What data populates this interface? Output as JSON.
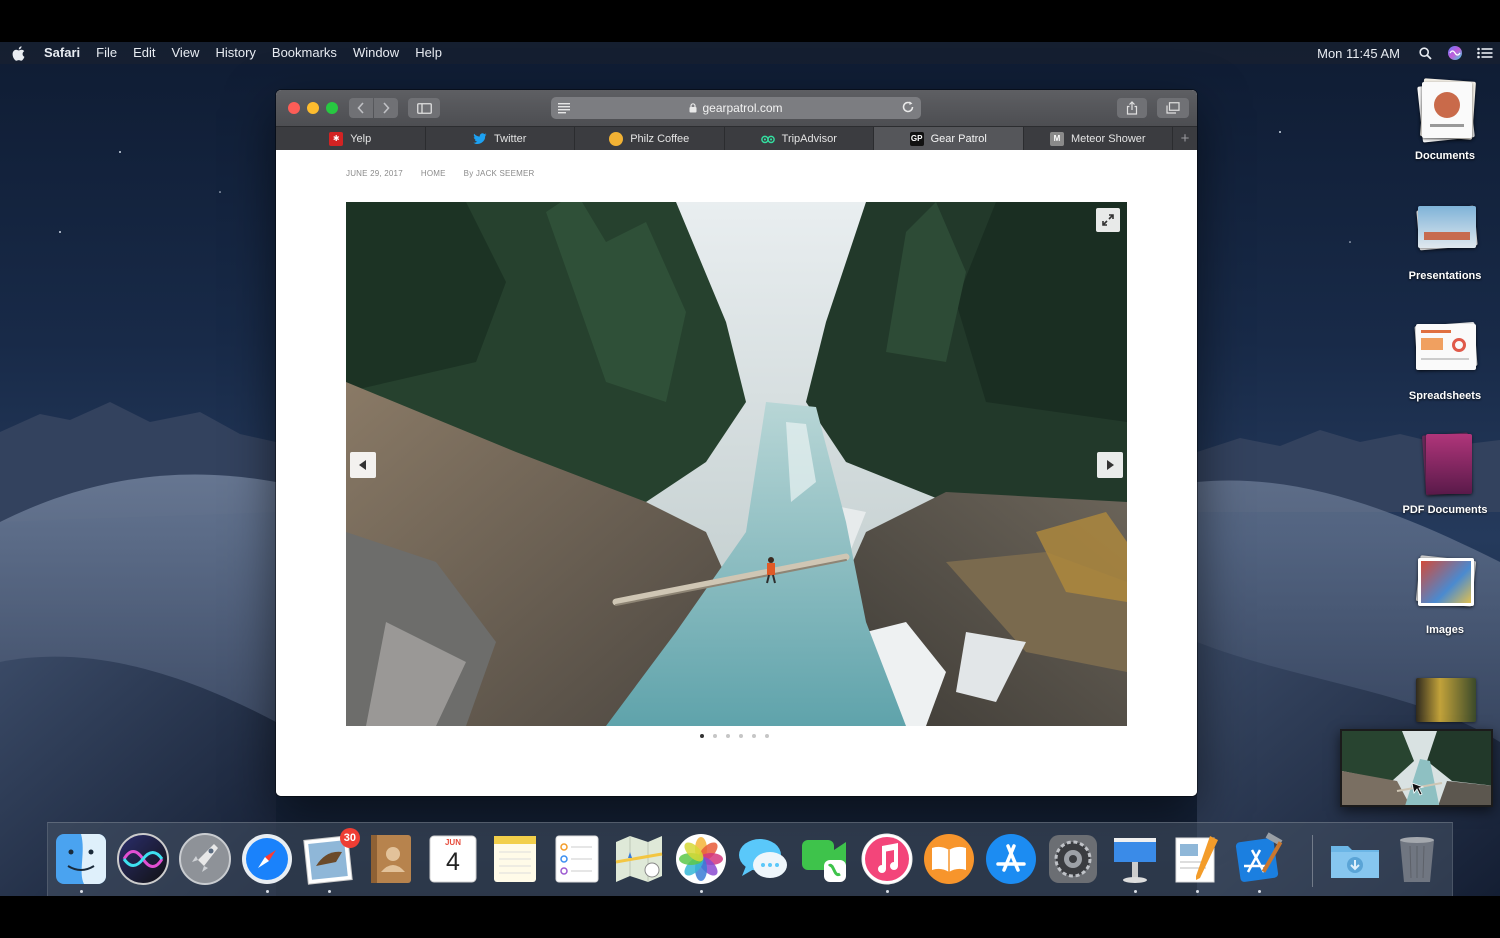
{
  "menubar": {
    "app_name": "Safari",
    "menus": [
      "File",
      "Edit",
      "View",
      "History",
      "Bookmarks",
      "Window",
      "Help"
    ],
    "clock": "Mon 11:45 AM",
    "icons": [
      "apple-icon",
      "spotlight-search-icon",
      "siri-icon",
      "notification-center-icon"
    ]
  },
  "safari": {
    "address": "gearpatrol.com",
    "tabs": [
      {
        "label": "Yelp",
        "icon": "yelp-favicon",
        "color": "#d32323"
      },
      {
        "label": "Twitter",
        "icon": "twitter-favicon",
        "color": "#1da1f2"
      },
      {
        "label": "Philz Coffee",
        "icon": "philz-favicon",
        "color": "#f2b234"
      },
      {
        "label": "TripAdvisor",
        "icon": "tripadvisor-favicon",
        "color": "#34e0a1"
      },
      {
        "label": "Gear Patrol",
        "icon": "gearpatrol-favicon",
        "color": "#111111",
        "active": true
      },
      {
        "label": "Meteor Shower",
        "icon": "m-favicon",
        "color": "#8a8a8a"
      }
    ],
    "article": {
      "date": "JUNE 29, 2017",
      "section": "HOME",
      "byline": "By JACK SEEMER"
    },
    "gallery": {
      "slides": 6,
      "current": 1
    }
  },
  "stacks": [
    {
      "label": "Documents",
      "icon": "documents-stack-icon"
    },
    {
      "label": "Presentations",
      "icon": "presentations-stack-icon"
    },
    {
      "label": "Spreadsheets",
      "icon": "spreadsheets-stack-icon"
    },
    {
      "label": "PDF Documents",
      "icon": "pdf-documents-stack-icon"
    },
    {
      "label": "Images",
      "icon": "images-stack-icon"
    }
  ],
  "dock": {
    "apps": [
      "Finder",
      "Siri",
      "Launchpad",
      "Safari",
      "Mail",
      "Contacts",
      "Calendar",
      "Notes",
      "Reminders",
      "Maps",
      "Photos",
      "Messages",
      "FaceTime",
      "iTunes",
      "iBooks",
      "App Store",
      "System Preferences",
      "Keynote",
      "Pages",
      "Xcode"
    ],
    "mail_badge": "30",
    "calendar_month": "JUN",
    "calendar_day": "4",
    "downloads": "Downloads",
    "trash": "Trash"
  },
  "colors": {
    "menubar_bg": "#182030",
    "window_chrome": "#4d4e52",
    "accent": "#1a82fb"
  }
}
